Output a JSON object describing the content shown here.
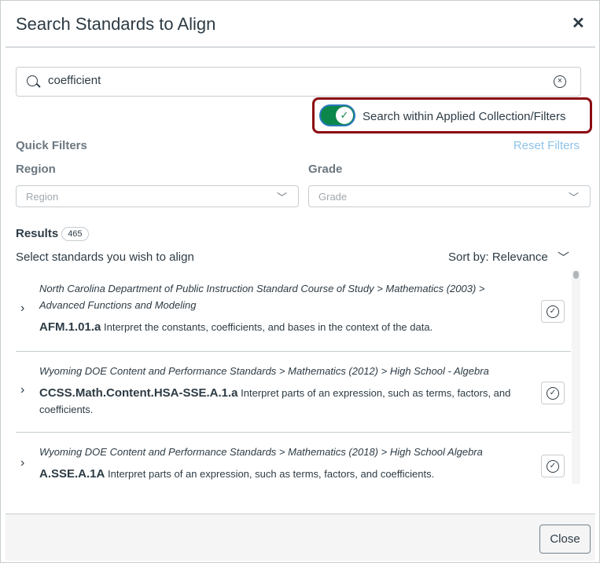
{
  "title": "Search Standards to Align",
  "search": {
    "value": "coefficient",
    "placeholder": ""
  },
  "toggle": {
    "label": "Search within Applied Collection/Filters",
    "on": true
  },
  "filters": {
    "heading": "Quick Filters",
    "reset": "Reset Filters",
    "region": {
      "label": "Region",
      "placeholder": "Region"
    },
    "grade": {
      "label": "Grade",
      "placeholder": "Grade"
    }
  },
  "results": {
    "label": "Results",
    "count": "465",
    "instruction": "Select standards you wish to align",
    "sort": "Sort by: Relevance",
    "items": [
      {
        "path": "North Carolina Department of Public Instruction Standard Course of Study > Mathematics (2003) > Advanced Functions and Modeling",
        "code": "AFM.1.01.a",
        "desc": "Interpret the constants, coefficients, and bases in the context of the data."
      },
      {
        "path": "Wyoming DOE Content and Performance Standards > Mathematics (2012) > High School - Algebra",
        "code": "CCSS.Math.Content.HSA-SSE.A.1.a",
        "desc": "Interpret parts of an expression, such as terms, factors, and coefficients."
      },
      {
        "path": "Wyoming DOE Content and Performance Standards > Mathematics (2018) > High School Algebra",
        "code": "A.SSE.A.1A",
        "desc": "Interpret parts of an expression, such as terms, factors, and coefficients."
      }
    ]
  },
  "footer": {
    "close": "Close"
  },
  "colors": {
    "toggle": "#0b874b",
    "highlight": "#8b0a10",
    "link": "#8fc3e8"
  }
}
